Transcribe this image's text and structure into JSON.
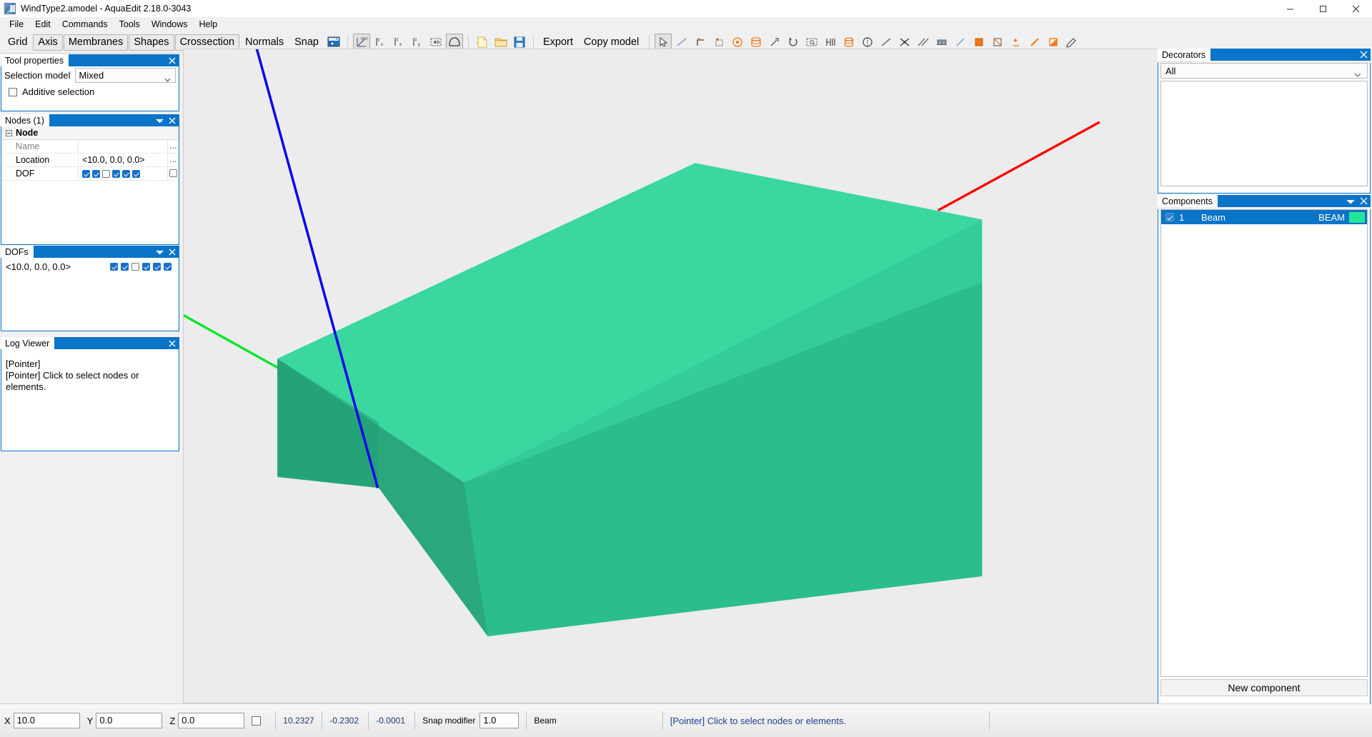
{
  "window": {
    "title": "WindType2.amodel - AquaEdit 2.18.0-3043",
    "app_icon": "app-icon",
    "minimize": "minimize-icon",
    "maximize": "maximize-icon",
    "close": "close-icon"
  },
  "menubar": {
    "items": [
      {
        "label": "File"
      },
      {
        "label": "Edit"
      },
      {
        "label": "Commands"
      },
      {
        "label": "Tools"
      },
      {
        "label": "Windows"
      },
      {
        "label": "Help"
      }
    ]
  },
  "toolbar": {
    "text_buttons": [
      {
        "label": "Grid",
        "boxed": false
      },
      {
        "label": "Axis",
        "boxed": true
      },
      {
        "label": "Membranes",
        "boxed": true
      },
      {
        "label": "Shapes",
        "boxed": true
      },
      {
        "label": "Crossection",
        "boxed": true
      },
      {
        "label": "Normals",
        "boxed": false
      },
      {
        "label": "Snap",
        "boxed": false
      }
    ],
    "export_label": "Export",
    "copy_model_label": "Copy model",
    "icons": [
      {
        "name": "snap-settings-icon"
      },
      {
        "name": "isometric-view-icon"
      },
      {
        "name": "view-x-icon"
      },
      {
        "name": "view-z-x-icon"
      },
      {
        "name": "view-z-y-icon"
      },
      {
        "name": "zoom-extents-icon"
      },
      {
        "name": "membrane-shape-icon"
      },
      {
        "name": "new-file-icon"
      },
      {
        "name": "open-folder-icon"
      },
      {
        "name": "save-icon"
      },
      {
        "name": "pointer-select-icon"
      },
      {
        "name": "line-draw-icon"
      },
      {
        "name": "add-node-icon"
      },
      {
        "name": "add-mesh-icon"
      },
      {
        "name": "add-point-load-icon"
      },
      {
        "name": "stack-icon"
      },
      {
        "name": "scale-icon"
      },
      {
        "name": "rotate-icon"
      },
      {
        "name": "fit-selection-icon"
      },
      {
        "name": "extrude-icon"
      },
      {
        "name": "cylinder-icon"
      },
      {
        "name": "mirror-icon"
      },
      {
        "name": "beam-line-icon"
      },
      {
        "name": "intersect-icon"
      },
      {
        "name": "parallel-lines-icon"
      },
      {
        "name": "support-icon"
      },
      {
        "name": "diagonal-line-icon"
      },
      {
        "name": "fill-square-icon"
      },
      {
        "name": "cut-square-icon"
      },
      {
        "name": "add-vertex-icon"
      },
      {
        "name": "edge-select-icon"
      },
      {
        "name": "face-select-icon"
      },
      {
        "name": "annotate-icon"
      }
    ]
  },
  "tool_properties": {
    "title": "Tool properties",
    "close": "close-icon",
    "selection_model_label": "Selection model",
    "selection_model_value": "Mixed",
    "additive_selection_label": "Additive selection",
    "additive_selection_checked": false
  },
  "nodes_panel": {
    "title": "Nodes (1)",
    "collapse": "chevron-down-icon",
    "close": "close-icon",
    "group_label": "Node",
    "rows": [
      {
        "name": "Name",
        "value": "",
        "dots": "...",
        "dim": true
      },
      {
        "name": "Location",
        "value": "<10.0, 0.0, 0.0>",
        "dots": "...",
        "dim": false
      }
    ],
    "dof_row_label": "DOF",
    "dof_values": [
      true,
      true,
      false,
      true,
      true,
      true
    ],
    "dof_extra_checked": false
  },
  "dofs_panel": {
    "title": "DOFs",
    "collapse": "chevron-down-icon",
    "close": "close-icon",
    "entry_label": "<10.0, 0.0, 0.0>",
    "entry_values": [
      true,
      true,
      false,
      true,
      true,
      true
    ]
  },
  "log_viewer": {
    "title": "Log Viewer",
    "close": "close-icon",
    "lines": [
      "[Pointer]",
      "[Pointer] Click to select nodes or",
      "elements."
    ]
  },
  "decorators": {
    "title": "Decorators",
    "close": "close-icon",
    "filter_value": "All"
  },
  "components": {
    "title": "Components",
    "collapse": "chevron-down-icon",
    "close": "close-icon",
    "rows": [
      {
        "index": "1",
        "name": "Beam",
        "type": "BEAM",
        "color": "#23e59a",
        "checked": true,
        "selected": true
      }
    ],
    "new_component_label": "New component"
  },
  "viewport": {
    "background": "#ececec",
    "model": {
      "top_face_color": "#3ad79f",
      "front_face_color": "#25b485",
      "side_face_color": "#2fc394",
      "dark_edge_color": "#1f9e74"
    },
    "axes": [
      {
        "name": "x-axis-line",
        "color": "#fe0000"
      },
      {
        "name": "y-axis-line",
        "color": "#00e628"
      },
      {
        "name": "z-axis-line",
        "color": "#0000ee"
      }
    ]
  },
  "statusbar": {
    "x_label": "X",
    "x_value": "10.0",
    "y_label": "Y",
    "y_value": "0.0",
    "z_label": "Z",
    "z_value": "0.0",
    "lock_checked": false,
    "readout": [
      "10.2327",
      "-0.2302",
      "-0.0001"
    ],
    "snap_modifier_label": "Snap modifier",
    "snap_modifier_value": "1.0",
    "context_label": "Beam",
    "message": "[Pointer] Click to select nodes or elements."
  }
}
